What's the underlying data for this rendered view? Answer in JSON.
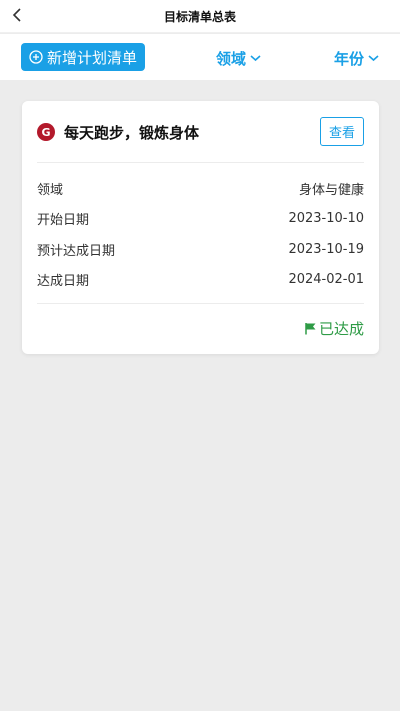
{
  "header": {
    "title": "目标清单总表"
  },
  "toolbar": {
    "add_label": "新增计划清单",
    "filter_domain": "领域",
    "filter_year": "年份"
  },
  "card": {
    "badge": "G",
    "title": "每天跑步，锻炼身体",
    "view_label": "查看",
    "rows": [
      {
        "label": "领域",
        "value": "身体与健康"
      },
      {
        "label": "开始日期",
        "value": "2023-10-10"
      },
      {
        "label": "预计达成日期",
        "value": "2023-10-19"
      },
      {
        "label": "达成日期",
        "value": "2024-02-01"
      }
    ],
    "status": "已达成"
  },
  "colors": {
    "accent": "#1aa0e6",
    "badge": "#b3192b",
    "success": "#2e9b46"
  }
}
